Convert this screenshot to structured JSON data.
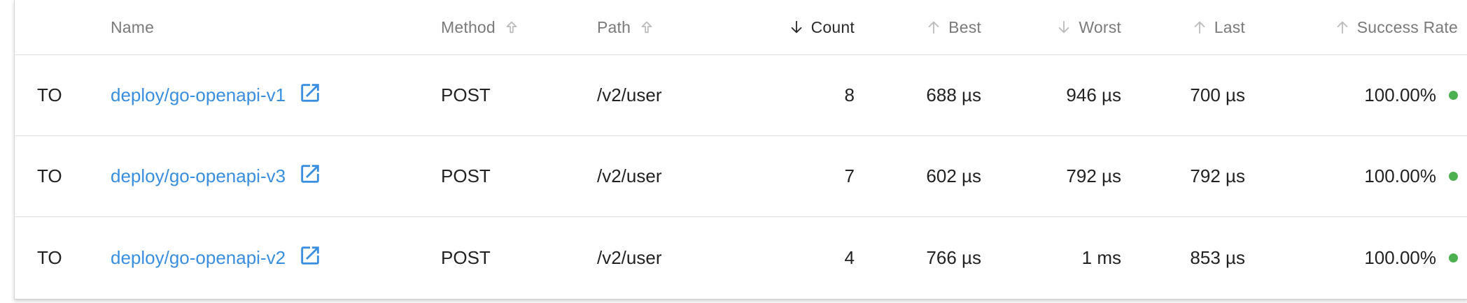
{
  "colors": {
    "link": "#3a8ee0",
    "success_dot": "#4caf50",
    "header_text": "#7a7a7a",
    "header_active_text": "#2a2a2a",
    "body_text": "#222222"
  },
  "header": {
    "name": "Name",
    "method": "Method",
    "path": "Path",
    "count": "Count",
    "best": "Best",
    "worst": "Worst",
    "last": "Last",
    "success_rate": "Success Rate",
    "sort": {
      "method": "ascending",
      "path": "ascending",
      "count": "descending-active",
      "best": "ascending",
      "worst": "descending",
      "last": "ascending",
      "success_rate": "ascending"
    }
  },
  "rows": [
    {
      "status": "TO",
      "name": "deploy/go-openapi-v1",
      "method": "POST",
      "path": "/v2/user",
      "count": "8",
      "best": "688 µs",
      "worst": "946 µs",
      "last": "700 µs",
      "success_rate": "100.00%",
      "status_icon": "green-dot"
    },
    {
      "status": "TO",
      "name": "deploy/go-openapi-v3",
      "method": "POST",
      "path": "/v2/user",
      "count": "7",
      "best": "602 µs",
      "worst": "792 µs",
      "last": "792 µs",
      "success_rate": "100.00%",
      "status_icon": "green-dot"
    },
    {
      "status": "TO",
      "name": "deploy/go-openapi-v2",
      "method": "POST",
      "path": "/v2/user",
      "count": "4",
      "best": "766 µs",
      "worst": "1 ms",
      "last": "853 µs",
      "success_rate": "100.00%",
      "status_icon": "green-dot"
    }
  ],
  "icons": {
    "external_link": "open-in-new-icon",
    "sort_up": "arrow-up-icon",
    "sort_down": "arrow-down-icon"
  }
}
